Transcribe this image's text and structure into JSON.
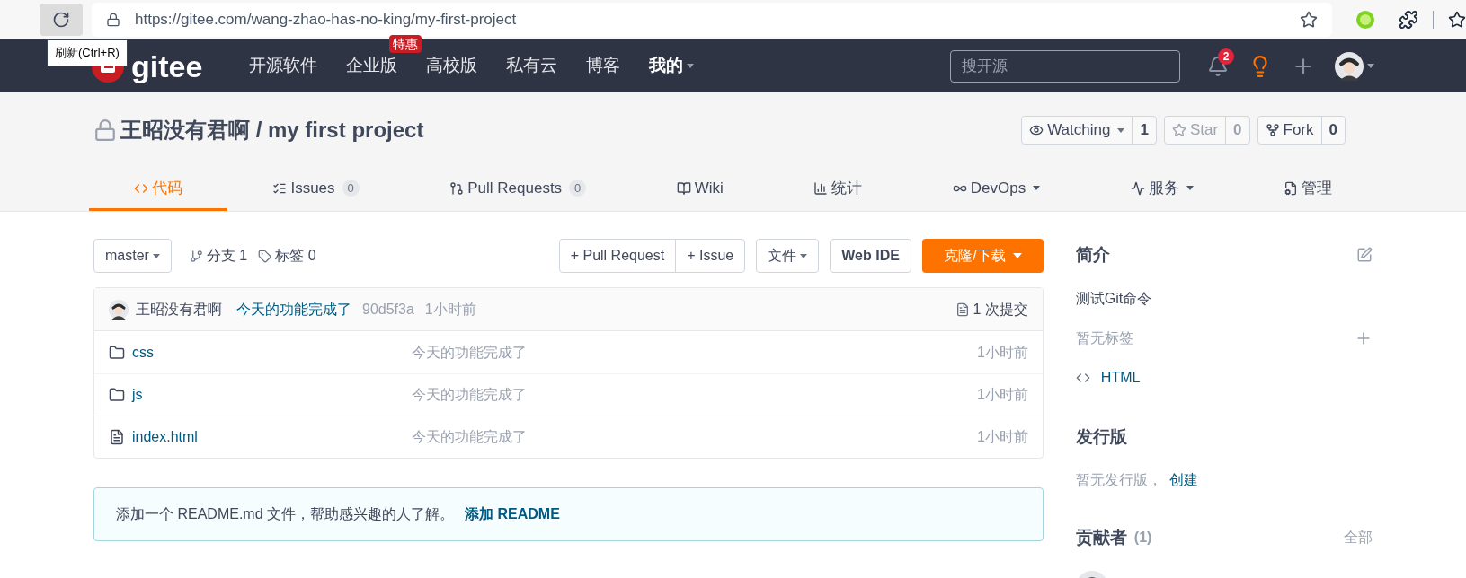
{
  "browser": {
    "url": "https://gitee.com/wang-zhao-has-no-king/my-first-project",
    "tooltip": "刷新(Ctrl+R)"
  },
  "header": {
    "logo": "gitee",
    "nav": [
      {
        "label": "开源软件",
        "dropdown": false
      },
      {
        "label": "企业版",
        "badge": "特惠",
        "dropdown": false
      },
      {
        "label": "高校版",
        "dropdown": false
      },
      {
        "label": "私有云",
        "dropdown": false
      },
      {
        "label": "博客",
        "dropdown": false
      },
      {
        "label": "我的",
        "dropdown": true
      }
    ],
    "search": {
      "placeholder": "搜开源"
    },
    "notifications": "2"
  },
  "repo": {
    "owner": "王昭没有君啊",
    "separator": "/",
    "name": "my first project",
    "private": true,
    "actions": [
      {
        "label": "Watching",
        "count": "1",
        "disabled": false,
        "dropdown": true,
        "kind": "eye"
      },
      {
        "label": "Star",
        "count": "0",
        "disabled": true,
        "dropdown": false,
        "kind": "star"
      },
      {
        "label": "Fork",
        "count": "0",
        "disabled": false,
        "dropdown": false,
        "kind": "fork"
      }
    ]
  },
  "tabs": [
    {
      "label": "代码",
      "kind": "code",
      "dropdown": false,
      "selected": true
    },
    {
      "label": "Issues",
      "count": "0",
      "kind": "issues",
      "dropdown": false,
      "selected": false
    },
    {
      "label": "Pull Requests",
      "count": "0",
      "kind": "pr",
      "dropdown": false,
      "selected": false
    },
    {
      "label": "Wiki",
      "kind": "wiki",
      "dropdown": false,
      "selected": false
    },
    {
      "label": "统计",
      "kind": "stats",
      "dropdown": false,
      "selected": false
    },
    {
      "label": "DevOps",
      "kind": "devops",
      "dropdown": true,
      "selected": false
    },
    {
      "label": "服务",
      "kind": "service",
      "dropdown": true,
      "selected": false
    },
    {
      "label": "管理",
      "kind": "manage",
      "dropdown": false,
      "selected": false
    }
  ],
  "toolbar": {
    "branch": "master",
    "branches": "分支 1",
    "tags": "标签 0",
    "pull_request": "+ Pull Request",
    "issue": "+ Issue",
    "file": "文件",
    "web_ide": "Web IDE",
    "clone": "克隆/下载"
  },
  "commit": {
    "author": "王昭没有君啊",
    "message": "今天的功能完成了",
    "hash": "90d5f3a",
    "time": "1小时前",
    "commits": "1 次提交"
  },
  "files": [
    {
      "name": "css",
      "kind": "folder",
      "message": "今天的功能完成了",
      "time": "1小时前"
    },
    {
      "name": "js",
      "kind": "folder",
      "message": "今天的功能完成了",
      "time": "1小时前"
    },
    {
      "name": "index.html",
      "kind": "file",
      "message": "今天的功能完成了",
      "time": "1小时前"
    }
  ],
  "readme": {
    "text": "添加一个 README.md 文件，帮助感兴趣的人了解。",
    "link": "添加 README"
  },
  "sidebar": {
    "intro_title": "简介",
    "description": "测试Git命令",
    "no_tags": "暂无标签",
    "language": "HTML",
    "releases_title": "发行版",
    "no_releases": "暂无发行版，",
    "create": "创建",
    "contributors_title": "贡献者",
    "contributors_count": "(1)",
    "all": "全部"
  }
}
